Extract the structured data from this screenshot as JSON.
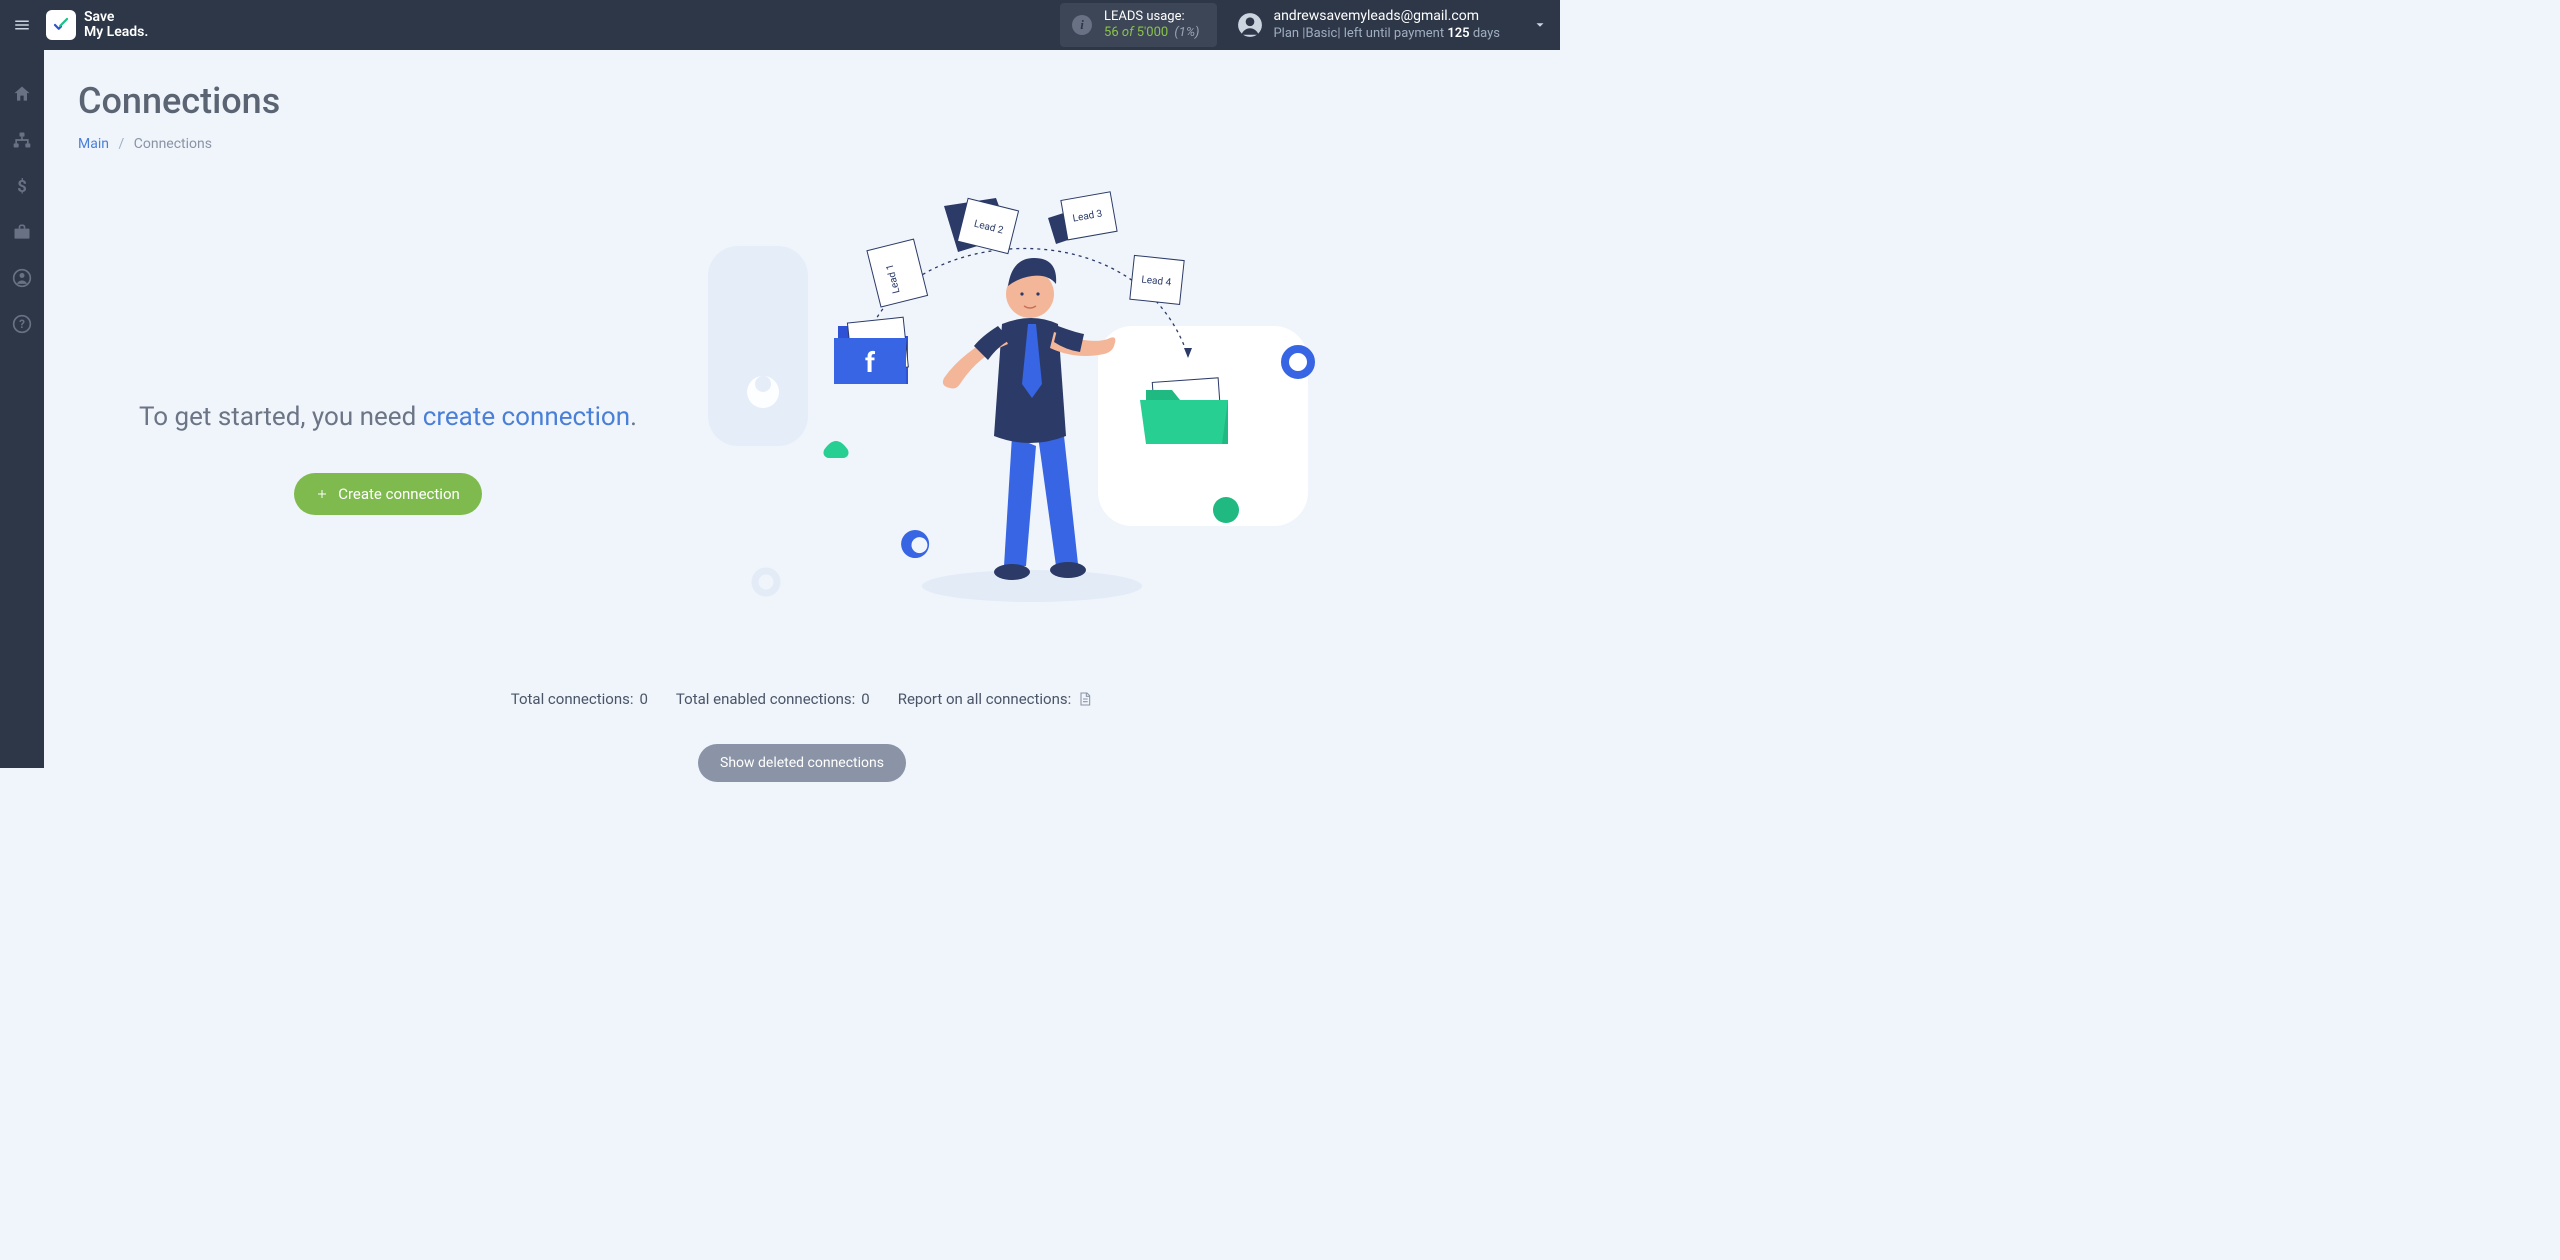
{
  "brand": {
    "line1": "Save",
    "line2": "My Leads."
  },
  "usage": {
    "label": "LEADS usage:",
    "used": "56",
    "of_word": "of",
    "total": "5'000",
    "pct": "(1%)"
  },
  "account": {
    "email": "andrewsavemyleads@gmail.com",
    "plan_prefix": "Plan |",
    "plan_name": "Basic",
    "plan_mid": "| left until payment",
    "days_num": "125",
    "days_word": "days"
  },
  "page": {
    "title": "Connections",
    "crumb_main": "Main",
    "crumb_current": "Connections"
  },
  "cta": {
    "pre": "To get started, you need ",
    "link": "create connection",
    "post": ".",
    "button": "Create connection"
  },
  "illus": {
    "lead1": "Lead 1",
    "lead2": "Lead 2",
    "lead3": "Lead 3",
    "lead4": "Lead 4",
    "fb": "f"
  },
  "stats": {
    "total_label": "Total connections:",
    "total_val": "0",
    "enabled_label": "Total enabled connections:",
    "enabled_val": "0",
    "report_label": "Report on all connections:"
  },
  "show_deleted": "Show deleted connections"
}
